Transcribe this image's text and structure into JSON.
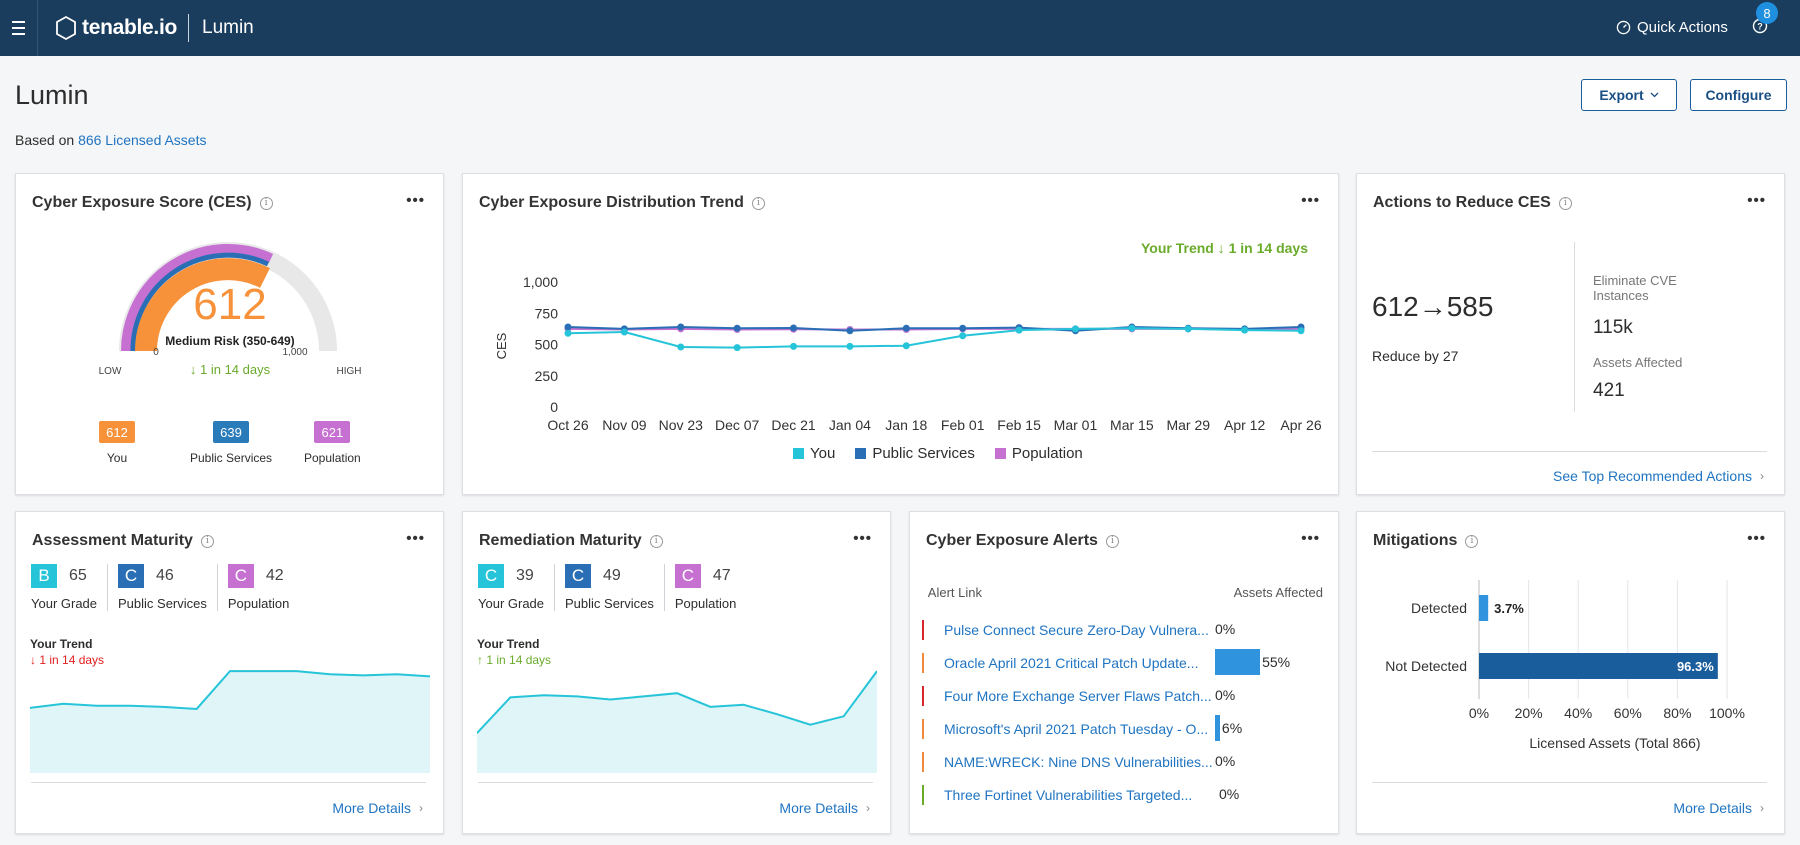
{
  "header": {
    "brand": "tenable.io",
    "app_name": "Lumin",
    "quick_actions": "Quick Actions",
    "notification_count": "8"
  },
  "page": {
    "title": "Lumin",
    "based_on_prefix": "Based on",
    "based_on_link": "866 Licensed Assets",
    "export_label": "Export",
    "configure_label": "Configure"
  },
  "ces": {
    "title": "Cyber Exposure Score (CES)",
    "score": "612",
    "risk_label": "Medium Risk (350-649)",
    "min": "0",
    "max": "1,000",
    "low": "LOW",
    "high": "HIGH",
    "trend": "↓ 1 in 14 days",
    "you_value": "612",
    "you_label": "You",
    "public_value": "639",
    "public_label": "Public Services",
    "population_value": "621",
    "population_label": "Population",
    "colors": {
      "you": "#f7923a",
      "public": "#2a7bba",
      "population": "#c671d2",
      "trend": "#6aab2a"
    }
  },
  "trend": {
    "title": "Cyber Exposure Distribution Trend",
    "your_trend": "Your Trend ↓ 1 in 14 days",
    "legend_you": "You",
    "legend_public": "Public Services",
    "legend_population": "Population"
  },
  "chart_data": [
    {
      "type": "line",
      "title": "Cyber Exposure Distribution Trend",
      "ylabel": "CES",
      "ylim": [
        0,
        1000
      ],
      "yticks": [
        "1,000",
        "750",
        "500",
        "250",
        "0"
      ],
      "x": [
        "Oct 26",
        "Nov 09",
        "Nov 23",
        "Dec 07",
        "Dec 21",
        "Jan 04",
        "Jan 18",
        "Feb 01",
        "Feb 15",
        "Mar 01",
        "Mar 15",
        "Mar 29",
        "Apr 12",
        "Apr 26"
      ],
      "series": [
        {
          "name": "You",
          "color": "#26c4d8",
          "values": [
            590,
            600,
            480,
            475,
            485,
            485,
            490,
            570,
            615,
            625,
            630,
            625,
            615,
            610
          ]
        },
        {
          "name": "Public Services",
          "color": "#2a6fb5",
          "values": [
            640,
            625,
            640,
            630,
            632,
            610,
            630,
            630,
            635,
            610,
            640,
            630,
            625,
            640
          ]
        },
        {
          "name": "Population",
          "color": "#c671d2",
          "values": [
            625,
            620,
            625,
            620,
            622,
            620,
            620,
            625,
            625,
            625,
            625,
            625,
            620,
            625
          ]
        }
      ]
    },
    {
      "type": "bar",
      "title": "Mitigations",
      "categories": [
        "Detected",
        "Not Detected"
      ],
      "values": [
        3.7,
        96.3
      ],
      "value_labels": [
        "3.7%",
        "96.3%"
      ],
      "xticks": [
        "0%",
        "20%",
        "40%",
        "60%",
        "80%",
        "100%"
      ],
      "xlabel": "Licensed Assets (Total 866)",
      "xlim": [
        0,
        100
      ]
    }
  ],
  "actions": {
    "title": "Actions to Reduce CES",
    "score_change": "612→585",
    "reduce_by": "Reduce by 27",
    "eliminate_label": "Eliminate CVE Instances",
    "eliminate_value": "115k",
    "assets_label": "Assets Affected",
    "assets_value": "421",
    "link": "See Top Recommended Actions"
  },
  "assessment": {
    "title": "Assessment Maturity",
    "grades": [
      {
        "grade": "B",
        "value": "65",
        "label": "Your Grade",
        "color": "#26c4d8"
      },
      {
        "grade": "C",
        "value": "46",
        "label": "Public Services",
        "color": "#2a6fb5"
      },
      {
        "grade": "C",
        "value": "42",
        "label": "Population",
        "color": "#c671d2"
      }
    ],
    "trend_label": "Your Trend",
    "trend_value": "↓ 1 in 14 days",
    "trend_color": "#e02020",
    "spark": [
      0.62,
      0.66,
      0.64,
      0.64,
      0.63,
      0.61,
      0.97,
      0.97,
      0.97,
      0.94,
      0.93,
      0.94,
      0.92
    ],
    "more": "More Details"
  },
  "remediation": {
    "title": "Remediation Maturity",
    "grades": [
      {
        "grade": "C",
        "value": "39",
        "label": "Your Grade",
        "color": "#26c4d8"
      },
      {
        "grade": "C",
        "value": "49",
        "label": "Public Services",
        "color": "#2a6fb5"
      },
      {
        "grade": "C",
        "value": "47",
        "label": "Population",
        "color": "#c671d2"
      }
    ],
    "trend_label": "Your Trend",
    "trend_value": "↑ 1 in 14 days",
    "trend_color": "#6aab2a",
    "spark": [
      0.38,
      0.72,
      0.74,
      0.73,
      0.7,
      0.73,
      0.76,
      0.63,
      0.65,
      0.56,
      0.46,
      0.54,
      0.97
    ],
    "more": "More Details"
  },
  "alerts": {
    "title": "Cyber Exposure Alerts",
    "col_link": "Alert Link",
    "col_assets": "Assets Affected",
    "rows": [
      {
        "text": "Pulse Connect Secure Zero-Day Vulnera...",
        "pct": "0%",
        "value": 0,
        "color": "#d9262c"
      },
      {
        "text": "Oracle April 2021 Critical Patch Update...",
        "pct": "55%",
        "value": 55,
        "color": "#f08a3c"
      },
      {
        "text": "Four More Exchange Server Flaws Patch...",
        "pct": "0%",
        "value": 0,
        "color": "#d9262c"
      },
      {
        "text": "Microsoft's April 2021 Patch Tuesday - O...",
        "pct": "6%",
        "value": 6,
        "color": "#f08a3c"
      },
      {
        "text": "NAME:WRECK: Nine DNS Vulnerabilities...",
        "pct": "0%",
        "value": 0,
        "color": "#f08a3c"
      },
      {
        "text": "Three Fortinet Vulnerabilities Targeted...",
        "pct": "0%",
        "value": 0,
        "color": "#6aab2a"
      }
    ]
  },
  "mitigations": {
    "title": "Mitigations",
    "more": "More Details"
  }
}
